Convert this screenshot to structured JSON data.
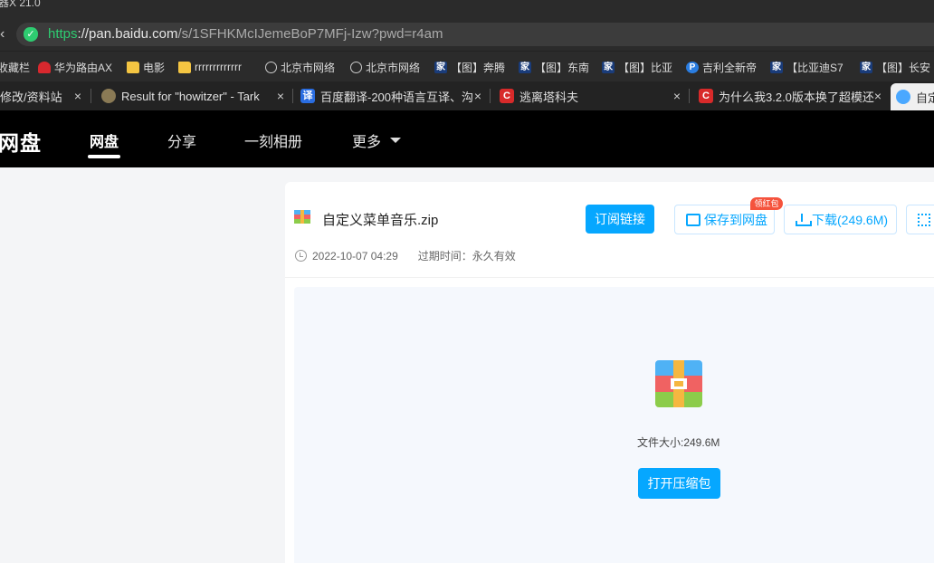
{
  "browser": {
    "title_fragment": "器X 21.0",
    "url": {
      "proto": "https",
      "host": "://pan.baidu.com",
      "path": "/s/1SFHKMcIJemeBoP7MFj-Izw?pwd=r4am"
    },
    "bookmarks": [
      {
        "label": "收藏栏",
        "icon": "none"
      },
      {
        "label": "华为路由AX",
        "icon": "huawei-icon"
      },
      {
        "label": "电影",
        "icon": "folder-icon"
      },
      {
        "label": "rrrrrrrrrrrrr",
        "icon": "folder-icon"
      },
      {
        "label": "北京市网络",
        "icon": "globe-icon"
      },
      {
        "label": "北京市网络",
        "icon": "globe-icon"
      },
      {
        "label": "【图】奔腾",
        "icon": "home-icon"
      },
      {
        "label": "【图】东南",
        "icon": "home-icon"
      },
      {
        "label": "【图】比亚",
        "icon": "home-icon"
      },
      {
        "label": "吉利全新帝",
        "icon": "p-icon"
      },
      {
        "label": "【比亚迪S7",
        "icon": "home-icon"
      },
      {
        "label": "【图】长安",
        "icon": "home-icon"
      }
    ],
    "tabs": [
      {
        "label": "修改/资料站",
        "close": "×"
      },
      {
        "label": "Result for \"howitzer\" - Tark",
        "close": "×"
      },
      {
        "label": "百度翻译-200种语言互译、沟",
        "close": "×"
      },
      {
        "label": "逃离塔科夫",
        "close": "×"
      },
      {
        "label": "为什么我3.2.0版本换了超模还",
        "close": "×"
      },
      {
        "label": "自定",
        "close": ""
      }
    ],
    "tab_icon_chars": {
      "translate": "译"
    }
  },
  "site": {
    "logo": "网盘",
    "nav": [
      {
        "label": "网盘",
        "active": true
      },
      {
        "label": "分享",
        "active": false
      },
      {
        "label": "一刻相册",
        "active": false
      },
      {
        "label": "更多",
        "active": false
      }
    ]
  },
  "file": {
    "name": "自定义菜单音乐.zip",
    "date": "2022-10-07 04:29",
    "expire_label": "过期时间：永久有效",
    "size_label": "文件大小:249.6M"
  },
  "actions": {
    "subscribe": "订阅链接",
    "save": "保存到网盘",
    "save_badge": "领红包",
    "download": "下载(249.6M)",
    "open_zip": "打开压缩包"
  },
  "colors": {
    "accent": "#06a7ff",
    "badge": "#f5533d",
    "secure": "#2ecc71"
  }
}
